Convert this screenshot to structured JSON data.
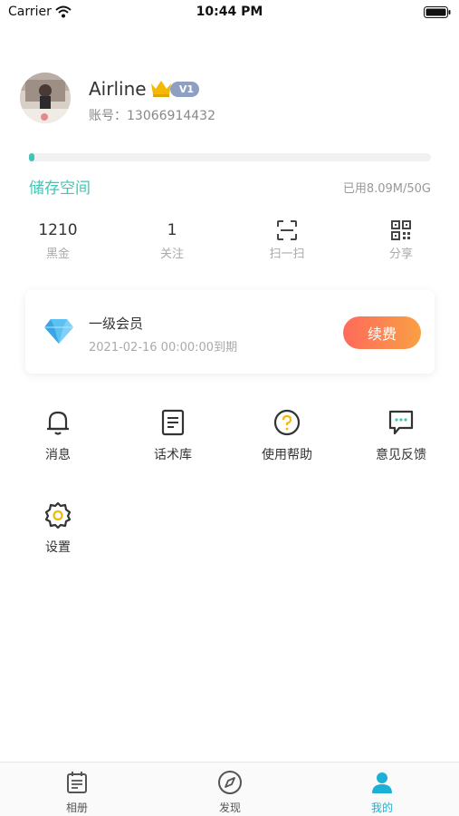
{
  "status_bar": {
    "carrier": "Carrier",
    "time": "10:44 PM"
  },
  "profile": {
    "name": "Airline",
    "vip_level": "V1",
    "account": "账号：13066914432"
  },
  "storage": {
    "label": "储存空间",
    "used_text": "已用8.09M/50G",
    "used_fraction": 0.0002
  },
  "stats": [
    {
      "value": "1210",
      "label": "黑金"
    },
    {
      "value": "1",
      "label": "关注"
    },
    {
      "icon": "scan-icon",
      "label": "扫一扫"
    },
    {
      "icon": "qr-code-icon",
      "label": "分享"
    }
  ],
  "vip_card": {
    "title": "一级会员",
    "expiry": "2021-02-16 00:00:00到期",
    "renew_label": "续费"
  },
  "menu": [
    {
      "icon": "bell-icon",
      "label": "消息"
    },
    {
      "icon": "document-icon",
      "label": "话术库"
    },
    {
      "icon": "help-icon",
      "label": "使用帮助"
    },
    {
      "icon": "feedback-icon",
      "label": "意见反馈"
    },
    {
      "icon": "gear-icon",
      "label": "设置"
    }
  ],
  "tabs": [
    {
      "icon": "calendar-icon",
      "label": "相册"
    },
    {
      "icon": "compass-icon",
      "label": "发现"
    },
    {
      "icon": "person-icon",
      "label": "我的",
      "active": true
    }
  ],
  "colors": {
    "accent": "#3cc8b4",
    "tab_active": "#1cb0d6",
    "renew_start": "#ff6a5c",
    "renew_end": "#f9a044",
    "vip_badge": "#8da0c4"
  }
}
